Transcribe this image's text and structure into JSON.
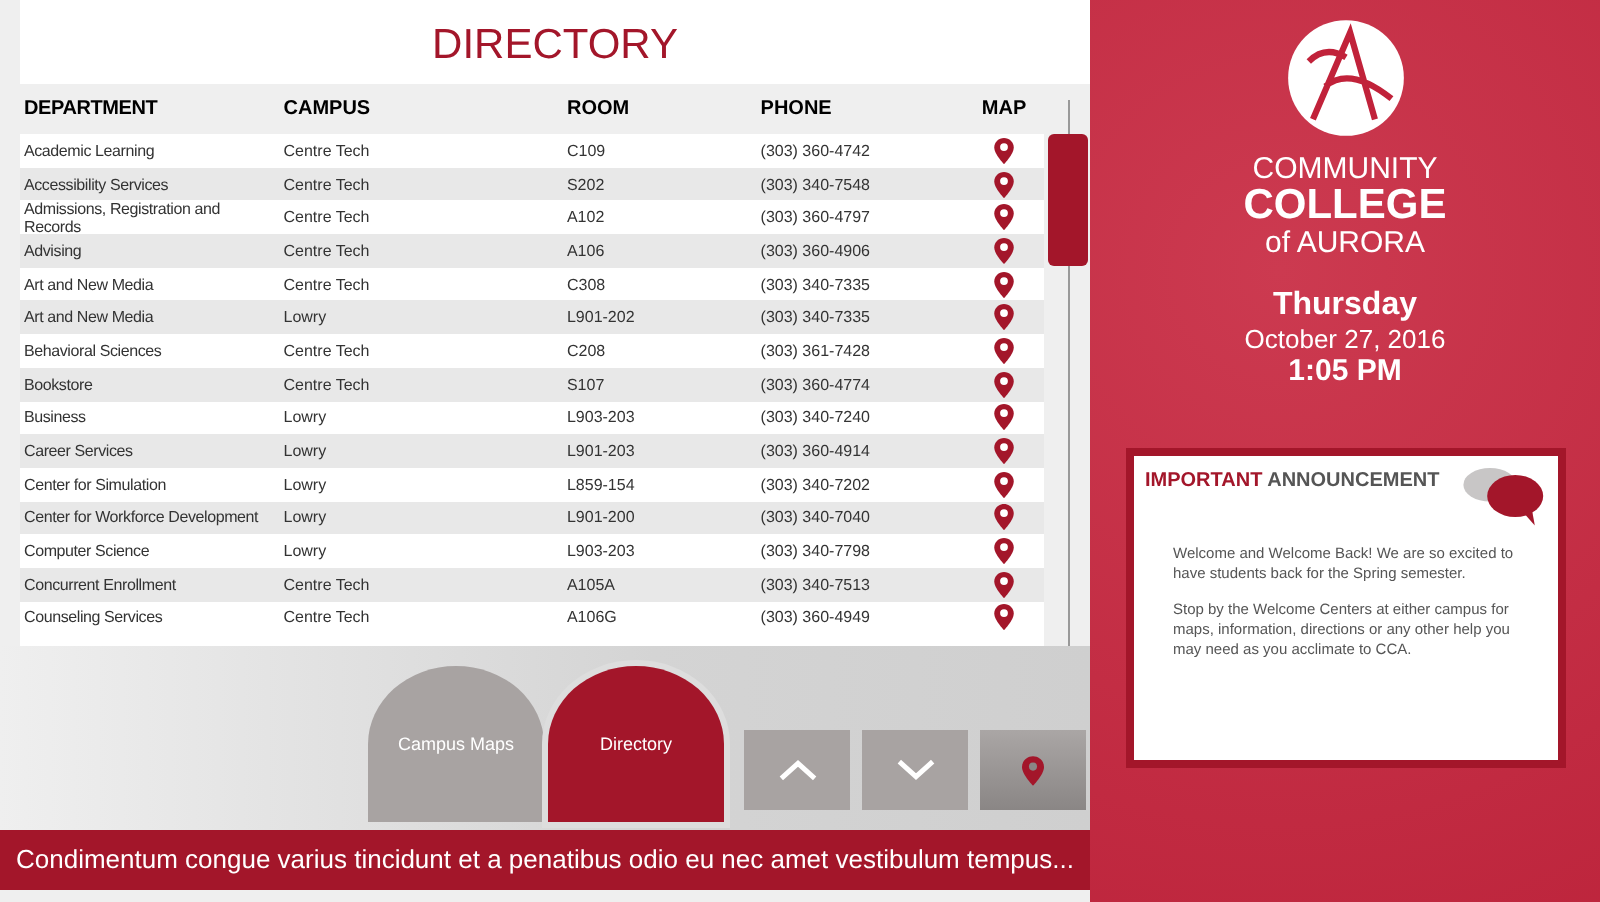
{
  "title": "DIRECTORY",
  "table": {
    "columns": [
      "DEPARTMENT",
      "CAMPUS",
      "ROOM",
      "PHONE",
      "MAP"
    ],
    "rows": [
      {
        "department": "Academic Learning",
        "campus": "Centre Tech",
        "room": "C109",
        "phone": "(303) 360-4742"
      },
      {
        "department": "Accessibility Services",
        "campus": "Centre Tech",
        "room": "S202",
        "phone": "(303) 340-7548"
      },
      {
        "department": "Admissions, Registration and Records",
        "campus": "Centre Tech",
        "room": "A102",
        "phone": "(303) 360-4797"
      },
      {
        "department": "Advising",
        "campus": "Centre Tech",
        "room": "A106",
        "phone": "(303) 360-4906"
      },
      {
        "department": "Art and New Media",
        "campus": "Centre Tech",
        "room": "C308",
        "phone": "(303) 340-7335"
      },
      {
        "department": "Art and New Media",
        "campus": "Lowry",
        "room": "L901-202",
        "phone": "(303) 340-7335"
      },
      {
        "department": "Behavioral Sciences",
        "campus": "Centre Tech",
        "room": "C208",
        "phone": "(303) 361-7428"
      },
      {
        "department": "Bookstore",
        "campus": "Centre Tech",
        "room": "S107",
        "phone": "(303) 360-4774"
      },
      {
        "department": "Business",
        "campus": "Lowry",
        "room": "L903-203",
        "phone": "(303) 340-7240"
      },
      {
        "department": "Career Services",
        "campus": "Lowry",
        "room": "L901-203",
        "phone": "(303) 360-4914"
      },
      {
        "department": "Center for Simulation",
        "campus": "Lowry",
        "room": "L859-154",
        "phone": "(303) 340-7202"
      },
      {
        "department": "Center for Workforce Development",
        "campus": "Lowry",
        "room": "L901-200",
        "phone": "(303) 340-7040"
      },
      {
        "department": "Computer Science",
        "campus": "Lowry",
        "room": "L903-203",
        "phone": "(303) 340-7798"
      },
      {
        "department": "Concurrent Enrollment",
        "campus": "Centre Tech",
        "room": "A105A",
        "phone": "(303) 340-7513"
      },
      {
        "department": "Counseling Services",
        "campus": "Centre Tech",
        "room": "A106G",
        "phone": "(303) 360-4949"
      }
    ]
  },
  "nav": [
    {
      "label": "Campus Maps",
      "selected": false
    },
    {
      "label": "Directory",
      "selected": true
    }
  ],
  "ticker": "Condimentum congue varius tincidunt et a penatibus odio eu nec amet vestibulum tempus...",
  "logo": {
    "line1": "COMMUNITY",
    "line2": "COLLEGE",
    "line3": "of AURORA"
  },
  "date": {
    "day": "Thursday",
    "date": "October 27, 2016",
    "time": "1:05 PM"
  },
  "announcement": {
    "title_strong": "IMPORTANT",
    "title_rest": "ANNOUNCEMENT",
    "paragraphs": [
      "Welcome and Welcome Back! We are so excited to have students back for the Spring semester.",
      "Stop by the Welcome Centers at either campus for maps, information, directions or any other help you may need as you acclimate to CCA."
    ]
  }
}
